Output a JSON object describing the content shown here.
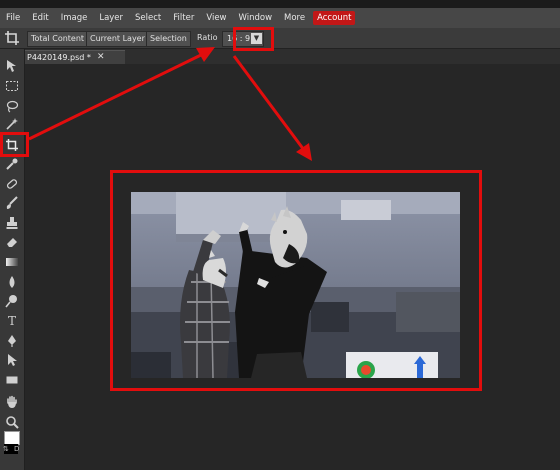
{
  "menu": [
    "File",
    "Edit",
    "Image",
    "Layer",
    "Select",
    "Filter",
    "View",
    "Window",
    "More",
    "Account"
  ],
  "options": {
    "total_content": "Total Content",
    "current_layer": "Current Layer",
    "selection": "Selection",
    "ratio_label": "Ratio",
    "ratio_value": "16 : 9"
  },
  "document": {
    "tab_name": "P4420149.psd *",
    "close_glyph": "✕"
  },
  "toolbar": {
    "type_tool": "T",
    "swap_label": "⇅",
    "default_label": "D"
  },
  "colors": {
    "menubar": "#474747",
    "account_accent": "#c21717",
    "annotation_red": "#e20d0d",
    "workspace": "#262626"
  },
  "icons": [
    "move-icon",
    "marquee-icon",
    "lasso-icon",
    "magic-wand-icon",
    "crop-icon",
    "eyedropper-icon",
    "healing-icon",
    "brush-icon",
    "stamp-icon",
    "eraser-icon",
    "gradient-icon",
    "blur-icon",
    "dodge-icon",
    "type-icon",
    "pen-icon",
    "path-select-icon",
    "shape-icon",
    "hand-icon",
    "zoom-icon"
  ]
}
